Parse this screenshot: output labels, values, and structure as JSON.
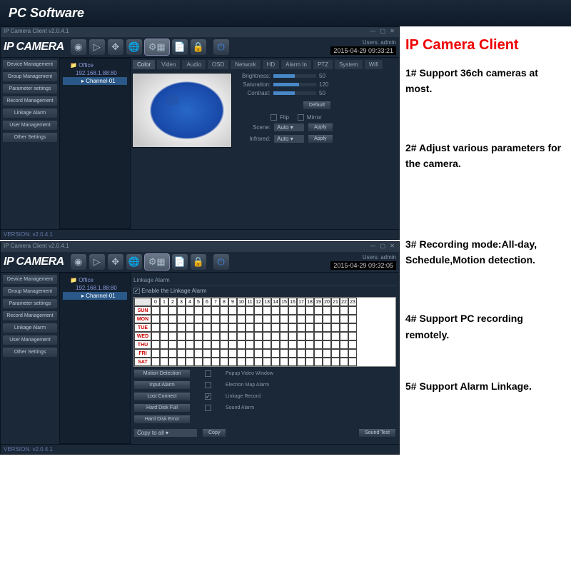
{
  "page_header": "PC Software",
  "right": {
    "title": "IP Camera Client",
    "features": [
      "1# Support 36ch cameras at most.",
      "2# Adjust various parameters for the camera.",
      "3# Recording mode:All-day, Schedule,Motion detection.",
      "4# Support PC recording remotely.",
      "5# Support Alarm Linkage."
    ]
  },
  "app": {
    "logo": "IP CAMERA",
    "title_top": "IP Camera Client v2.0.4.1",
    "user_label": "Users: admin",
    "ts1": "2015-04-29 09:33:21",
    "ts2": "2015-04-29 09:32:05",
    "version": "VERSION: v2.0.4.1",
    "sidebar": [
      "Device Management",
      "Group Management",
      "Parameter settings",
      "Record Management",
      "Linkage Alarm",
      "User Management",
      "Other Settings"
    ],
    "tree": {
      "root": "Office",
      "ip": "192.168.1.88:80",
      "ch": "Channel-01"
    },
    "tabs": [
      "Color",
      "Video",
      "Audio",
      "OSD",
      "Network",
      "HD",
      "Alarm In",
      "PTZ",
      "System",
      "Wifi"
    ],
    "color": {
      "brightness_lbl": "Brightness:",
      "brightness_val": "50",
      "saturation_lbl": "Saturation:",
      "saturation_val": "120",
      "contrast_lbl": "Contrast:",
      "contrast_val": "50",
      "default_btn": "Default",
      "flip_lbl": "Flip",
      "mirror_lbl": "Mirror",
      "scene_lbl": "Scene:",
      "infrared_lbl": "Infrared:",
      "auto_opt": "Auto",
      "apply_btn": "Apply"
    },
    "linkage": {
      "title": "Linkage Alarm",
      "enable_lbl": "Enable the Linkage Alarm",
      "days": [
        "SUN",
        "MON",
        "TUE",
        "WED",
        "THU",
        "FRI",
        "SAT"
      ],
      "hours": [
        "0",
        "1",
        "2",
        "3",
        "4",
        "5",
        "6",
        "7",
        "8",
        "9",
        "10",
        "11",
        "12",
        "13",
        "14",
        "15",
        "16",
        "17",
        "18",
        "19",
        "20",
        "21",
        "22",
        "23"
      ],
      "btns": [
        "Motion Detection",
        "Input Alarm",
        "Lost Connect",
        "Hard Disk Full",
        "Hard Disk Error"
      ],
      "chks": [
        "Popup Video Window",
        "Electron Map Alarm",
        "Linkage Record",
        "Sound Alarm"
      ],
      "copy_sel": "Copy to all",
      "copy_btn": "Copy",
      "sound_test": "Sound Test"
    }
  }
}
